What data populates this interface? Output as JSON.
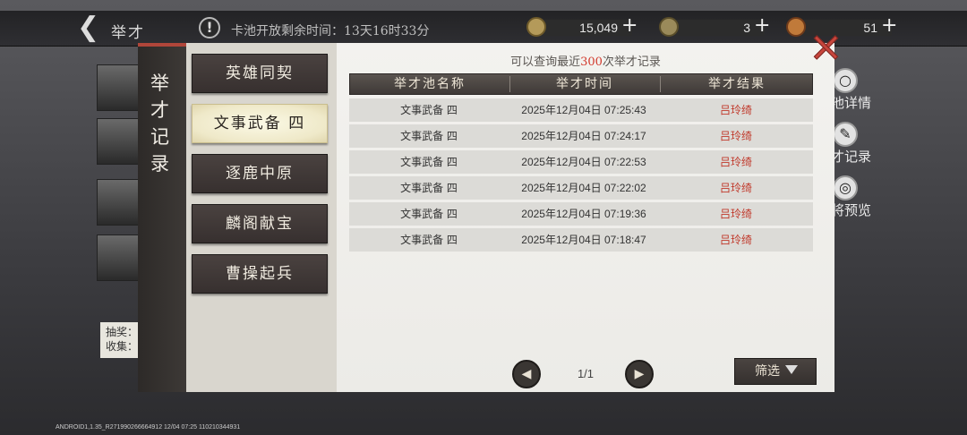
{
  "header": {
    "back_icon": "chevron-left-icon",
    "title": "举才",
    "notice_icon": "!",
    "pool_timer": "卡池开放剩余时间：13天16时33分",
    "resources": [
      {
        "icon": "coin-icon",
        "value": "15,049",
        "color": "#b49a5a"
      },
      {
        "icon": "jade-icon",
        "value": "3",
        "color": "#9a8a5a"
      },
      {
        "icon": "token-icon",
        "value": "51",
        "color": "#c07a3a"
      }
    ]
  },
  "background": {
    "note_text": "抽奖：收集：",
    "side_buttons": [
      {
        "icon": "magnifier-icon",
        "glyph": "🔍",
        "label": "池详情"
      },
      {
        "icon": "brush-icon",
        "glyph": "✎",
        "label": "才记录"
      },
      {
        "icon": "preview-icon",
        "glyph": "◎",
        "label": "将预览"
      }
    ],
    "version": "ANDROID1,1.35_R271990266664912 12/04 07:25 110210344931"
  },
  "modal": {
    "vertical_title": "举才记录",
    "tabs": [
      {
        "label": "英雄同契",
        "active": false
      },
      {
        "label": "文事武备 四",
        "active": true
      },
      {
        "label": "逐鹿中原",
        "active": false
      },
      {
        "label": "麟阁献宝",
        "active": false
      },
      {
        "label": "曹操起兵",
        "active": false
      }
    ],
    "hint": {
      "prefix": "可以查询最近",
      "count": "300",
      "suffix": "次举才记录"
    },
    "columns": [
      "举才池名称",
      "举才时间",
      "举才结果"
    ],
    "rows": [
      {
        "pool": "文事武备 四",
        "time": "2025年12月04日 07:25:43",
        "result": "吕玲绮"
      },
      {
        "pool": "文事武备 四",
        "time": "2025年12月04日 07:24:17",
        "result": "吕玲绮"
      },
      {
        "pool": "文事武备 四",
        "time": "2025年12月04日 07:22:53",
        "result": "吕玲绮"
      },
      {
        "pool": "文事武备 四",
        "time": "2025年12月04日 07:22:02",
        "result": "吕玲绮"
      },
      {
        "pool": "文事武备 四",
        "time": "2025年12月04日 07:19:36",
        "result": "吕玲绮"
      },
      {
        "pool": "文事武备 四",
        "time": "2025年12月04日 07:18:47",
        "result": "吕玲绮"
      }
    ],
    "pager": {
      "prev_glyph": "◀",
      "next_glyph": "▶",
      "text": "1/1"
    },
    "filter_label": "筛选",
    "colors": {
      "accent_red": "#c0392b",
      "title_bar_red": "#b0463a"
    }
  }
}
